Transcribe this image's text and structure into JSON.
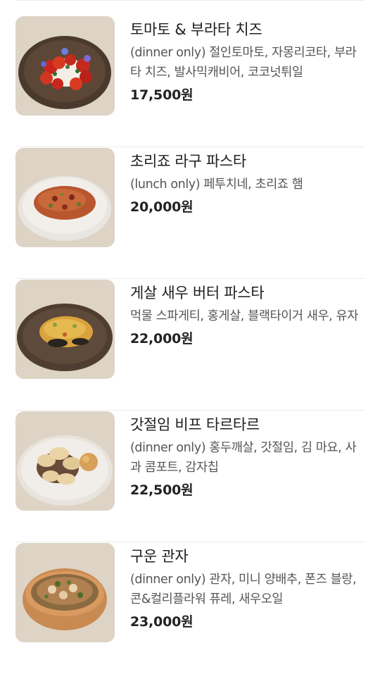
{
  "menu": {
    "items": [
      {
        "name": "토마토 & 부라타 치즈",
        "description": "(dinner only) 절인토마토, 자몽리코타, 부라타 치즈, 발사믹캐비어, 코코넛튀일",
        "price": "17,500원",
        "image_icon": "tomato-burrata-dish"
      },
      {
        "name": "초리죠 라구 파스타",
        "description": "(lunch only) 페투치네, 초리죠 햄",
        "price": "20,000원",
        "image_icon": "chorizo-ragu-pasta-dish"
      },
      {
        "name": "게살 새우 버터 파스타",
        "description": "먹물 스파게티, 홍게살, 블랙타이거 새우, 유자",
        "price": "22,000원",
        "image_icon": "crab-shrimp-butter-pasta-dish"
      },
      {
        "name": "갓절임 비프 타르타르",
        "description": "(dinner only) 홍두깨살, 갓절임, 김 마요, 사과 콤포트, 감자칩",
        "price": "22,500원",
        "image_icon": "beef-tartare-dish"
      },
      {
        "name": "구운 관자",
        "description": "(dinner only) 관자, 미니 양배추, 폰즈 블랑, 콘&컬리플라워 퓨레, 새우오일",
        "price": "23,000원",
        "image_icon": "grilled-scallop-dish"
      }
    ]
  },
  "colors": {
    "background": "#ffffff",
    "divider": "#ececec",
    "title": "#1e1e1e",
    "description": "#555555",
    "price": "#222222"
  }
}
